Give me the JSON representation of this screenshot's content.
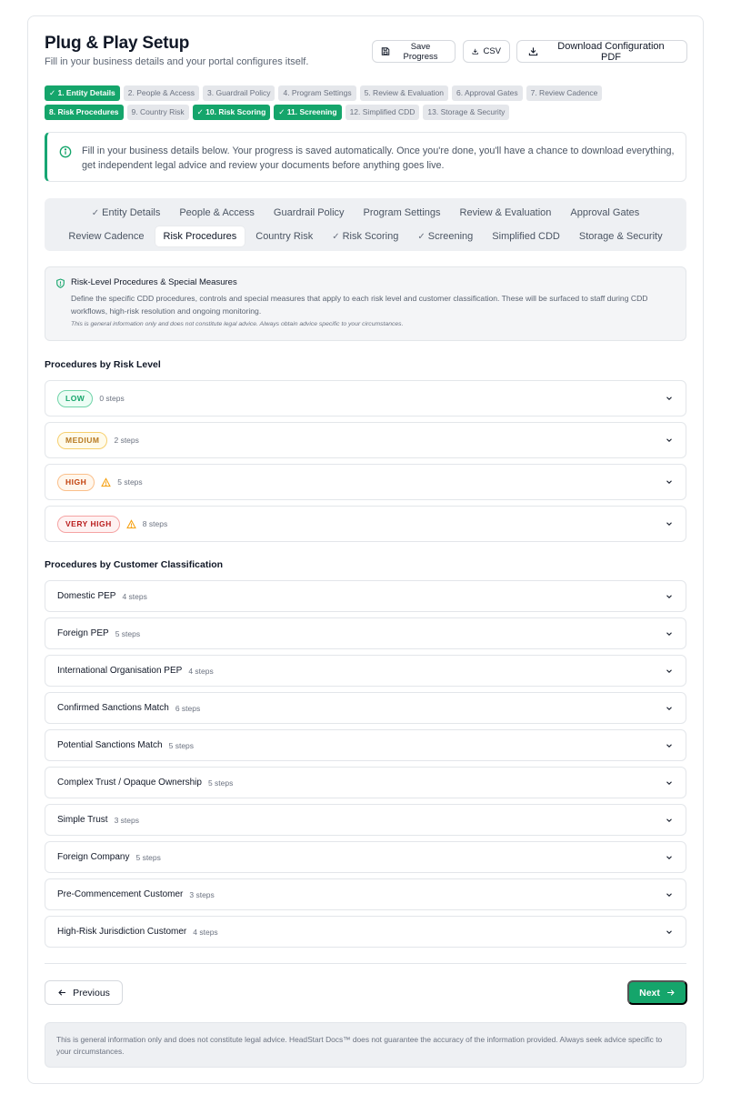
{
  "header": {
    "title": "Plug & Play Setup",
    "subtitle": "Fill in your business details and your portal configures itself.",
    "save_label": "Save Progress",
    "csv_label": "CSV",
    "pdf_label": "Download Configuration PDF"
  },
  "steps": [
    {
      "label": "✓ 1. Entity Details",
      "state": "done"
    },
    {
      "label": "2. People & Access",
      "state": "todo"
    },
    {
      "label": "3. Guardrail Policy",
      "state": "todo"
    },
    {
      "label": "4. Program Settings",
      "state": "todo"
    },
    {
      "label": "5. Review & Evaluation",
      "state": "todo"
    },
    {
      "label": "6. Approval Gates",
      "state": "todo"
    },
    {
      "label": "7. Review Cadence",
      "state": "todo"
    },
    {
      "label": "8. Risk Procedures",
      "state": "active"
    },
    {
      "label": "9. Country Risk",
      "state": "todo"
    },
    {
      "label": "✓ 10. Risk Scoring",
      "state": "done"
    },
    {
      "label": "✓ 11. Screening",
      "state": "done"
    },
    {
      "label": "12. Simplified CDD",
      "state": "todo"
    },
    {
      "label": "13. Storage & Security",
      "state": "todo"
    }
  ],
  "info_text": "Fill in your business details below. Your progress is saved automatically. Once you're done, you'll have a chance to download everything, get independent legal advice and review your documents before anything goes live.",
  "tabs": [
    {
      "label": "Entity Details",
      "check": true,
      "active": false
    },
    {
      "label": "People & Access",
      "check": false,
      "active": false
    },
    {
      "label": "Guardrail Policy",
      "check": false,
      "active": false
    },
    {
      "label": "Program Settings",
      "check": false,
      "active": false
    },
    {
      "label": "Review & Evaluation",
      "check": false,
      "active": false
    },
    {
      "label": "Approval Gates",
      "check": false,
      "active": false
    },
    {
      "label": "Review Cadence",
      "check": false,
      "active": false
    },
    {
      "label": "Risk Procedures",
      "check": false,
      "active": true
    },
    {
      "label": "Country Risk",
      "check": false,
      "active": false
    },
    {
      "label": "Risk Scoring",
      "check": true,
      "active": false
    },
    {
      "label": "Screening",
      "check": true,
      "active": false
    },
    {
      "label": "Simplified CDD",
      "check": false,
      "active": false
    },
    {
      "label": "Storage & Security",
      "check": false,
      "active": false
    }
  ],
  "section": {
    "title": "Risk-Level Procedures & Special Measures",
    "description": "Define the specific CDD procedures, controls and special measures that apply to each risk level and customer classification. These will be surfaced to staff during CDD workflows, high-risk resolution and ongoing monitoring.",
    "note": "This is general information only and does not constitute legal advice. Always obtain advice specific to your circumstances."
  },
  "risk_heading": "Procedures by Risk Level",
  "risk_levels": [
    {
      "label": "LOW",
      "steps": "0 steps",
      "warn": false,
      "color": "#15a56b",
      "bg": "#ecfdf5",
      "border": "#6fd3a8"
    },
    {
      "label": "MEDIUM",
      "steps": "2 steps",
      "warn": false,
      "color": "#b7791f",
      "bg": "#fffbeb",
      "border": "#f6cf6e"
    },
    {
      "label": "HIGH",
      "steps": "5 steps",
      "warn": true,
      "color": "#c2410c",
      "bg": "#fff7ed",
      "border": "#fbbf8a"
    },
    {
      "label": "VERY HIGH",
      "steps": "8 steps",
      "warn": true,
      "color": "#b91c1c",
      "bg": "#fef2f2",
      "border": "#f5a3a3"
    }
  ],
  "class_heading": "Procedures by Customer Classification",
  "classifications": [
    {
      "label": "Domestic PEP",
      "steps": "4 steps"
    },
    {
      "label": "Foreign PEP",
      "steps": "5 steps"
    },
    {
      "label": "International Organisation PEP",
      "steps": "4 steps"
    },
    {
      "label": "Confirmed Sanctions Match",
      "steps": "6 steps"
    },
    {
      "label": "Potential Sanctions Match",
      "steps": "5 steps"
    },
    {
      "label": "Complex Trust / Opaque Ownership",
      "steps": "5 steps"
    },
    {
      "label": "Simple Trust",
      "steps": "3 steps"
    },
    {
      "label": "Foreign Company",
      "steps": "5 steps"
    },
    {
      "label": "Pre-Commencement Customer",
      "steps": "3 steps"
    },
    {
      "label": "High-Risk Jurisdiction Customer",
      "steps": "4 steps"
    }
  ],
  "nav": {
    "previous": "Previous",
    "next": "Next"
  },
  "disclaimer": "This is general information only and does not constitute legal advice. HeadStart Docs™ does not guarantee the accuracy of the information provided. Always seek advice specific to your circumstances.",
  "colors": {
    "accent": "#15a56b",
    "warn": "#f59e0b"
  }
}
